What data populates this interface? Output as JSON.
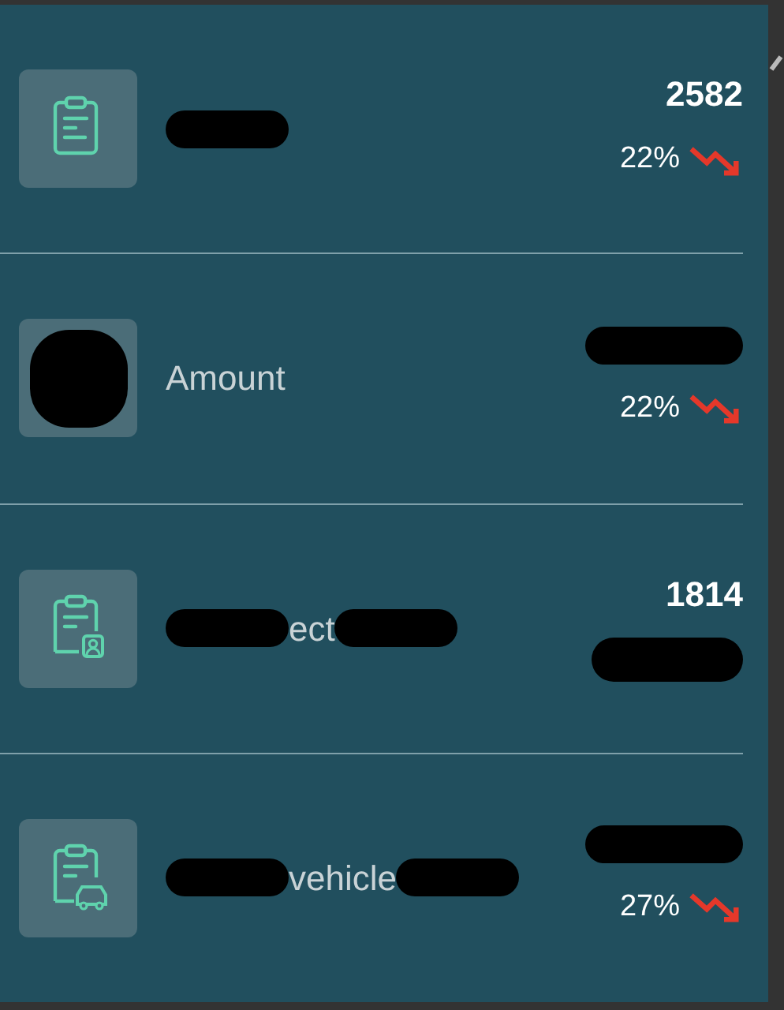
{
  "items": [
    {
      "kind": "clipboard",
      "label_parts": [
        {
          "kind": "redaction"
        }
      ],
      "value": "2582",
      "change": "22%"
    },
    {
      "kind": "redacted",
      "label_parts": [
        {
          "kind": "text",
          "text": "Amount"
        }
      ],
      "value_redacted": true,
      "change": "22%"
    },
    {
      "kind": "clipboard-person",
      "label_parts": [
        {
          "kind": "redaction"
        },
        {
          "kind": "text",
          "text": "ect"
        },
        {
          "kind": "redaction"
        }
      ],
      "value": "1814",
      "change_redacted": true
    },
    {
      "kind": "clipboard-car",
      "label_parts": [
        {
          "kind": "redaction"
        },
        {
          "kind": "text",
          "text": "vehicle"
        },
        {
          "kind": "redaction"
        }
      ],
      "value_redacted": true,
      "change": "27%"
    }
  ]
}
